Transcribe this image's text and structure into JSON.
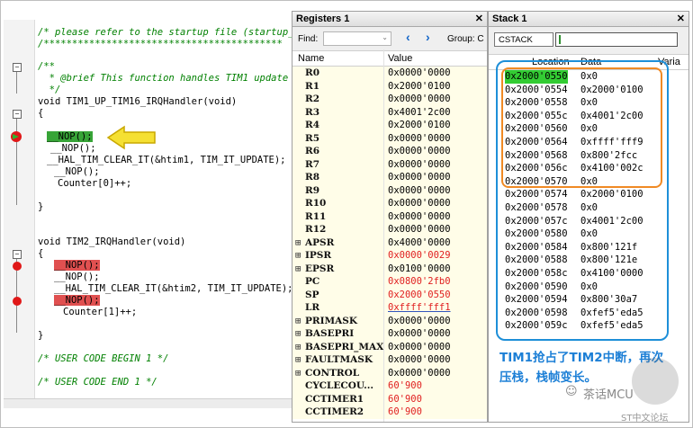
{
  "code": {
    "lines": [
      "/* please refer to the startup file (startup_s",
      "/******************************************",
      "/**",
      "  * @brief This function handles TIM1 update i",
      "  */",
      "void TIM1_UP_TIM16_IRQHandler(void)",
      "{",
      "__NOP();",
      "__NOP();",
      "__HAL_TIM_CLEAR_IT(&htim1, TIM_IT_UPDATE);",
      "__NOP();",
      "Counter[0]++;",
      "}",
      "void TIM2_IRQHandler(void)",
      "{",
      "__NOP();",
      "__NOP();",
      "__HAL_TIM_CLEAR_IT(&htim2, TIM_IT_UPDATE);",
      "__NOP();",
      "Counter[1]++;",
      "}",
      "/* USER CODE BEGIN 1 */",
      "/* USER CODE END 1 */"
    ]
  },
  "registers": {
    "title": "Registers 1",
    "find_label": "Find:",
    "group_label": "Group: C",
    "col_name": "Name",
    "col_value": "Value",
    "rows": [
      {
        "name": "R0",
        "value": "0x0000'0000",
        "expand": "",
        "red": false
      },
      {
        "name": "R1",
        "value": "0x2000'0100",
        "expand": "",
        "red": false
      },
      {
        "name": "R2",
        "value": "0x0000'0000",
        "expand": "",
        "red": false
      },
      {
        "name": "R3",
        "value": "0x4001'2c00",
        "expand": "",
        "red": false
      },
      {
        "name": "R4",
        "value": "0x2000'0100",
        "expand": "",
        "red": false
      },
      {
        "name": "R5",
        "value": "0x0000'0000",
        "expand": "",
        "red": false
      },
      {
        "name": "R6",
        "value": "0x0000'0000",
        "expand": "",
        "red": false
      },
      {
        "name": "R7",
        "value": "0x0000'0000",
        "expand": "",
        "red": false
      },
      {
        "name": "R8",
        "value": "0x0000'0000",
        "expand": "",
        "red": false
      },
      {
        "name": "R9",
        "value": "0x0000'0000",
        "expand": "",
        "red": false
      },
      {
        "name": "R10",
        "value": "0x0000'0000",
        "expand": "",
        "red": false
      },
      {
        "name": "R11",
        "value": "0x0000'0000",
        "expand": "",
        "red": false
      },
      {
        "name": "R12",
        "value": "0x0000'0000",
        "expand": "",
        "red": false
      },
      {
        "name": "APSR",
        "value": "0x4000'0000",
        "expand": "⊞",
        "red": false
      },
      {
        "name": "IPSR",
        "value": "0x0000'0029",
        "expand": "⊞",
        "red": true
      },
      {
        "name": "EPSR",
        "value": "0x0100'0000",
        "expand": "⊞",
        "red": false
      },
      {
        "name": "PC",
        "value": "0x0800'2fb0",
        "expand": "",
        "red": true
      },
      {
        "name": "SP",
        "value": "0x2000'0550",
        "expand": "",
        "red": true
      },
      {
        "name": "LR",
        "value": "0xffff'fff1",
        "expand": "",
        "red": true
      },
      {
        "name": "PRIMASK",
        "value": "0x0000'0000",
        "expand": "⊞",
        "red": false
      },
      {
        "name": "BASEPRI",
        "value": "0x0000'0000",
        "expand": "⊞",
        "red": false
      },
      {
        "name": "BASEPRI_MAX",
        "value": "0x0000'0000",
        "expand": "⊞",
        "red": false
      },
      {
        "name": "FAULTMASK",
        "value": "0x0000'0000",
        "expand": "⊞",
        "red": false
      },
      {
        "name": "CONTROL",
        "value": "0x0000'0000",
        "expand": "⊞",
        "red": false
      },
      {
        "name": "CYCLECOU...",
        "value": "60'900",
        "expand": "",
        "red": true
      },
      {
        "name": "CCTIMER1",
        "value": "60'900",
        "expand": "",
        "red": true
      },
      {
        "name": "CCTIMER2",
        "value": "60'900",
        "expand": "",
        "red": true
      }
    ]
  },
  "stack": {
    "title": "Stack 1",
    "selector": "CSTACK",
    "col_location": "Location",
    "col_data": "Data",
    "col_variable": "Varia",
    "rows": [
      {
        "location": "0x2000'0550",
        "data": "0x0"
      },
      {
        "location": "0x2000'0554",
        "data": "0x2000'0100"
      },
      {
        "location": "0x2000'0558",
        "data": "0x0"
      },
      {
        "location": "0x2000'055c",
        "data": "0x4001'2c00"
      },
      {
        "location": "0x2000'0560",
        "data": "0x0"
      },
      {
        "location": "0x2000'0564",
        "data": "0xffff'fff9"
      },
      {
        "location": "0x2000'0568",
        "data": "0x800'2fcc"
      },
      {
        "location": "0x2000'056c",
        "data": "0x4100'002c"
      },
      {
        "location": "0x2000'0570",
        "data": "0x0"
      },
      {
        "location": "0x2000'0574",
        "data": "0x2000'0100"
      },
      {
        "location": "0x2000'0578",
        "data": "0x0"
      },
      {
        "location": "0x2000'057c",
        "data": "0x4001'2c00"
      },
      {
        "location": "0x2000'0580",
        "data": "0x0"
      },
      {
        "location": "0x2000'0584",
        "data": "0x800'121f"
      },
      {
        "location": "0x2000'0588",
        "data": "0x800'121e"
      },
      {
        "location": "0x2000'058c",
        "data": "0x4100'0000"
      },
      {
        "location": "0x2000'0590",
        "data": "0x0"
      },
      {
        "location": "0x2000'0594",
        "data": "0x800'30a7"
      },
      {
        "location": "0x2000'0598",
        "data": "0xfef5'eda5"
      },
      {
        "location": "0x2000'059c",
        "data": "0xfef5'eda5"
      }
    ],
    "annotation": "TIM1抢占了TIM2中断，再次压栈，栈帧变长。"
  },
  "watermark": {
    "name": "茶话MCU",
    "sub": "ST中文论坛"
  },
  "colors": {
    "highlight_green": "#33cc33",
    "breakpoint_red": "#e01818",
    "annotation_blue": "#1c7fd6",
    "frame_orange": "#f08a24"
  }
}
